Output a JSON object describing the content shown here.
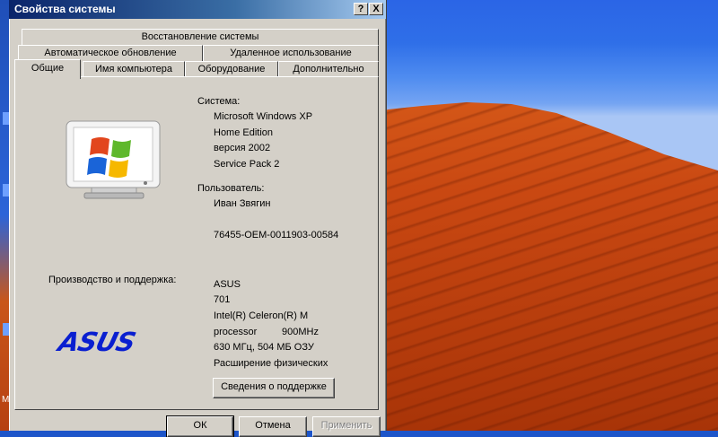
{
  "window": {
    "title": "Свойства системы",
    "help_button": "?",
    "close_button": "X"
  },
  "tabs": {
    "row1": [
      {
        "label": "Восстановление системы"
      }
    ],
    "row2": [
      {
        "label": "Автоматическое обновление"
      },
      {
        "label": "Удаленное использование"
      }
    ],
    "row3": [
      {
        "label": "Общие",
        "active": true
      },
      {
        "label": "Имя компьютера"
      },
      {
        "label": "Оборудование"
      },
      {
        "label": "Дополнительно"
      }
    ]
  },
  "general": {
    "system_label": "Система:",
    "system_lines": [
      "Microsoft Windows XP",
      "Home Edition",
      "версия 2002",
      "Service Pack 2"
    ],
    "user_label": "Пользователь:",
    "user_name": "Иван Звягин",
    "product_id": "76455-OEM-0011903-00584",
    "manufacturer_label": "Производство и поддержка:",
    "manufacturer_lines": [
      "ASUS",
      "701",
      "Intel(R) Celeron(R) M",
      "processor",
      "630 МГц, 504 МБ ОЗУ",
      "Расширение физических"
    ],
    "processor_speed": "900MHz",
    "support_button": "Сведения о поддержке",
    "oem_logo_text": "ASUS"
  },
  "footer": {
    "ok": "ОК",
    "cancel": "Отмена",
    "apply": "Применить"
  },
  "colors": {
    "titlebar_start": "#0a246a",
    "titlebar_end": "#a6caf0",
    "window_face": "#d4d0c8",
    "oem_logo": "#0a1fd0"
  },
  "desktop": {
    "edge_mark": "M"
  }
}
